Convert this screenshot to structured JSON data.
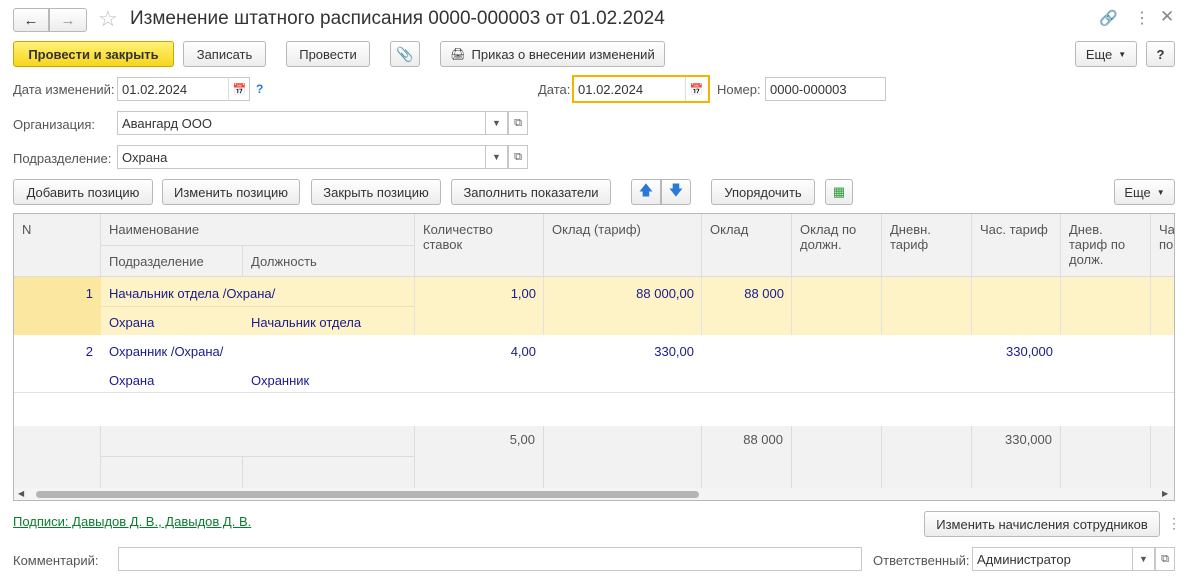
{
  "title": "Изменение штатного расписания 0000-000003 от 01.02.2024",
  "toolbar": {
    "post_close": "Провести и закрыть",
    "write": "Записать",
    "post": "Провести",
    "order": "Приказ о внесении изменений",
    "more": "Еще",
    "help": "?"
  },
  "form": {
    "change_date_label": "Дата изменений:",
    "change_date": "01.02.2024",
    "hint": "?",
    "date_label": "Дата:",
    "date": "01.02.2024",
    "number_label": "Номер:",
    "number": "0000-000003",
    "org_label": "Организация:",
    "org": "Авангард ООО",
    "dept_label": "Подразделение:",
    "dept": "Охрана"
  },
  "table_toolbar": {
    "add": "Добавить позицию",
    "edit": "Изменить позицию",
    "close": "Закрыть позицию",
    "fill": "Заполнить показатели",
    "sort": "Упорядочить",
    "more": "Еще"
  },
  "table": {
    "headers": {
      "n": "N",
      "name": "Наименование",
      "dept": "Подразделение",
      "position": "Должность",
      "rates": "Количество ставок",
      "salary_tariff": "Оклад (тариф)",
      "salary": "Оклад",
      "salary_by_pos": "Оклад по должн.",
      "day_tariff": "Дневн. тариф",
      "hour_tariff": "Час. тариф",
      "day_tariff_pos": "Днев. тариф по долж.",
      "hour_tariff_pos": "Ча по"
    },
    "rows": [
      {
        "n": "1",
        "name": "Начальник отдела /Охрана/",
        "dept": "Охрана",
        "position": "Начальник отдела",
        "rates": "1,00",
        "salary_tariff": "88 000,00",
        "salary": "88 000",
        "hour_tariff": ""
      },
      {
        "n": "2",
        "name": "Охранник /Охрана/",
        "dept": "Охрана",
        "position": "Охранник",
        "rates": "4,00",
        "salary_tariff": "330,00",
        "salary": "",
        "hour_tariff": "330,000"
      }
    ],
    "totals": {
      "rates": "5,00",
      "salary": "88 000",
      "hour_tariff": "330,000"
    }
  },
  "footer": {
    "signatures": "Подписи: Давыдов Д. В., Давыдов Д. В.",
    "change_accruals": "Изменить начисления сотрудников",
    "comment_label": "Комментарий:",
    "responsible_label": "Ответственный:",
    "responsible": "Администратор"
  },
  "colors": {
    "selected_row": "#fdf3c6",
    "primary_button": "#f7d51e",
    "link": "#0a7d2c",
    "cell_text": "#1a1a8c"
  }
}
